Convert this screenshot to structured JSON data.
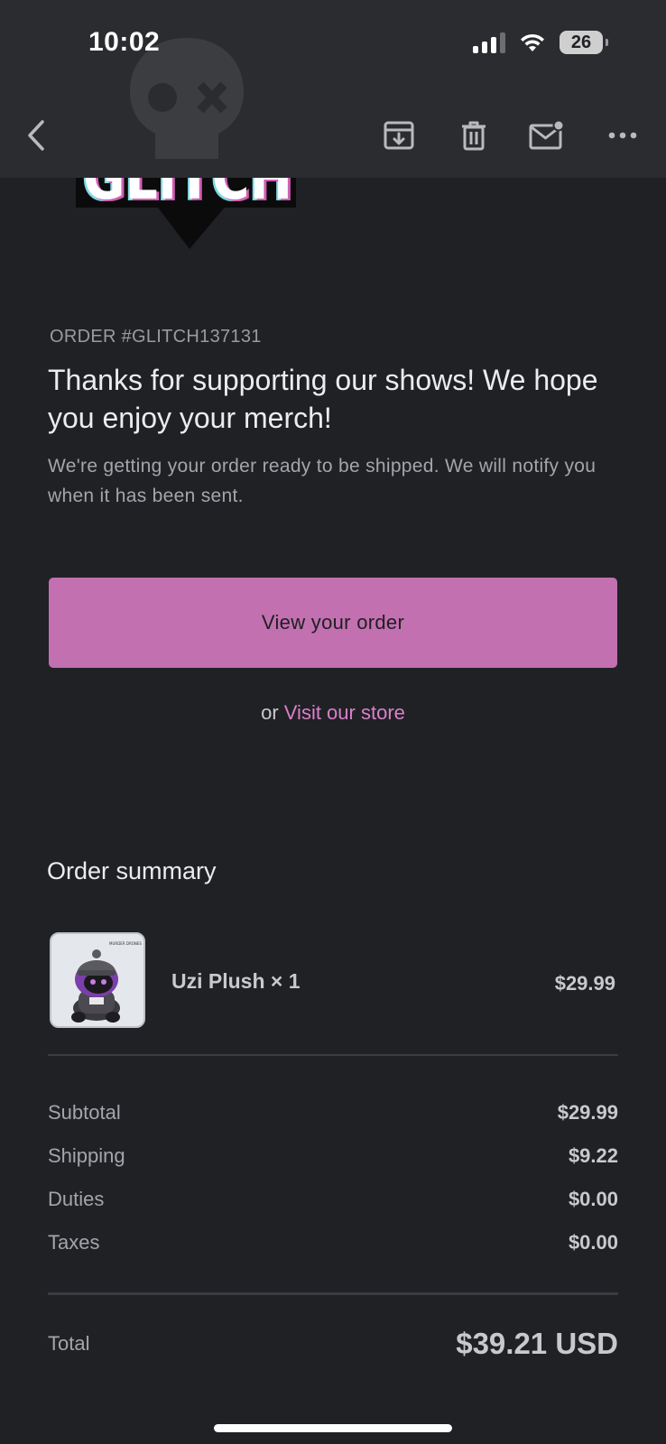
{
  "status_bar": {
    "time": "10:02",
    "battery_level": "26",
    "signal_bars": 3,
    "wifi": true
  },
  "toolbar": {
    "icons": [
      "back-icon",
      "archive-icon",
      "trash-icon",
      "mail-unread-icon",
      "more-icon"
    ]
  },
  "brand": {
    "logo_text": "GLITCH",
    "accent_color": "#c270b0",
    "link_color": "#d980c9"
  },
  "order": {
    "number_label": "ORDER #GLITCH137131",
    "headline": "Thanks for supporting our shows! We hope you enjoy your merch!",
    "subtext": "We're getting your order ready to be shipped. We will notify you when it has been sent.",
    "view_button_label": "View your order",
    "or_text": "or",
    "store_link_label": "Visit our store"
  },
  "summary": {
    "title": "Order summary",
    "items": [
      {
        "name": "Uzi Plush × 1",
        "price": "$29.99",
        "thumb_caption": "MURDER DRONES"
      }
    ],
    "rows": [
      {
        "label": "Subtotal",
        "value": "$29.99"
      },
      {
        "label": "Shipping",
        "value": "$9.22"
      },
      {
        "label": "Duties",
        "value": "$0.00"
      },
      {
        "label": "Taxes",
        "value": "$0.00"
      }
    ],
    "total_label": "Total",
    "total_value": "$39.21 USD"
  }
}
